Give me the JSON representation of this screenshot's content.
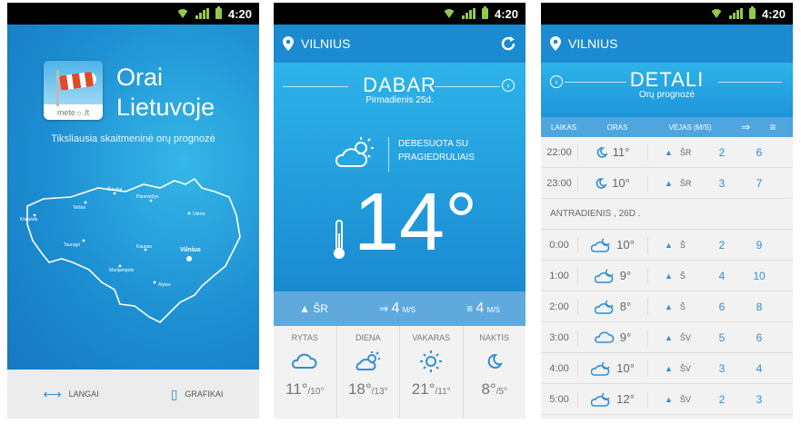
{
  "status": {
    "time": "4:20"
  },
  "screen1": {
    "app_title_line1": "Orai",
    "app_title_line2": "Lietuvoje",
    "logo_label": "mete☼.lt",
    "tagline": "Tiksliausia skaitmeninė orų prognozė",
    "cities": [
      "Klaipėda",
      "Telšiai",
      "Šiauliai",
      "Panevėžys",
      "Utena",
      "Tauragė",
      "Kaunas",
      "Marijampolė",
      "Alytus",
      "Vilnius"
    ],
    "bottom": {
      "winds_label": "LANGAI",
      "charts_label": "GRAFIKAI"
    }
  },
  "screen2": {
    "city": "VILNIUS",
    "title": "DABAR",
    "subtitle": "Pirmadienis 25d.",
    "desc_line1": "DEBESUOTA SU",
    "desc_line2": "PRAGIEDRULIAIS",
    "temp": "14°",
    "wind_dir": "ŠR",
    "wind_speed": "4",
    "wind_unit": "M/S",
    "gust_speed": "4",
    "gust_unit": "M/S",
    "dayparts": [
      {
        "name": "RYTAS",
        "hi": "11°",
        "lo": "/10°",
        "icon": "cloud-icon"
      },
      {
        "name": "DIENA",
        "hi": "18°",
        "lo": "/13°",
        "icon": "sun-cloud-icon"
      },
      {
        "name": "VAKARAS",
        "hi": "21°",
        "lo": "/11°",
        "icon": "sun-icon"
      },
      {
        "name": "NAKTIS",
        "hi": "8°",
        "lo": "/5°",
        "icon": "moon-icon"
      }
    ]
  },
  "screen3": {
    "city": "VILNIUS",
    "title": "DETALI",
    "subtitle": "Orų prognozė",
    "headers": {
      "time": "LAIKAS",
      "weather": "ORAS",
      "wind": "VĖJAS (M/S)"
    },
    "rows_before": [
      {
        "time": "22:00",
        "temp": "11°",
        "dir": "ŠR",
        "wind": "2",
        "gust": "6"
      },
      {
        "time": "23:00",
        "temp": "10°",
        "dir": "ŠR",
        "wind": "3",
        "gust": "7"
      }
    ],
    "day_label": "ANTRADIENIS , 26D .",
    "rows_after": [
      {
        "time": "0:00",
        "temp": "10°",
        "dir": "Š",
        "wind": "2",
        "gust": "9"
      },
      {
        "time": "1:00",
        "temp": "9°",
        "dir": "Š",
        "wind": "4",
        "gust": "10"
      },
      {
        "time": "2:00",
        "temp": "8°",
        "dir": "Š",
        "wind": "6",
        "gust": "8"
      },
      {
        "time": "3:00",
        "temp": "9°",
        "dir": "ŠV",
        "wind": "5",
        "gust": "6"
      },
      {
        "time": "4:00",
        "temp": "10°",
        "dir": "ŠV",
        "wind": "3",
        "gust": "4"
      },
      {
        "time": "5:00",
        "temp": "12°",
        "dir": "ŠV",
        "wind": "2",
        "gust": "3"
      }
    ]
  }
}
